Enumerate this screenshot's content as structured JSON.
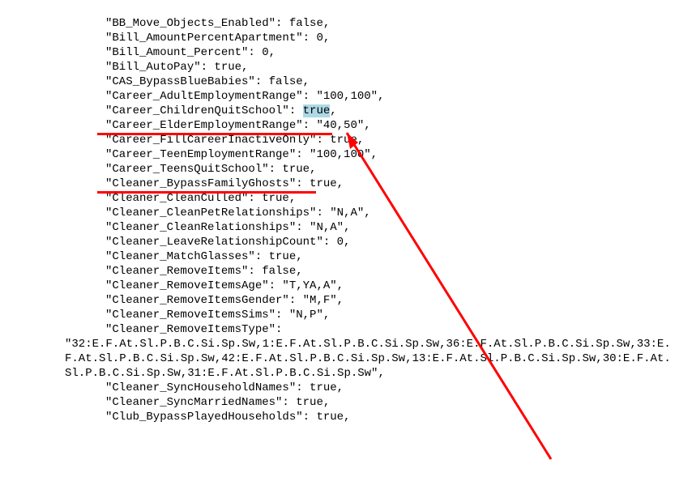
{
  "lines": {
    "l1": "\"BB_Move_Objects_Enabled\": false,",
    "l2": "\"Bill_AmountPercentApartment\": 0,",
    "l3": "\"Bill_Amount_Percent\": 0,",
    "l4": "\"Bill_AutoPay\": true,",
    "l5": "\"CAS_BypassBlueBabies\": false,",
    "l6": "\"Career_AdultEmploymentRange\": \"100,100\",",
    "l7a": "\"Career_ChildrenQuitSchool\": ",
    "l7b": "true",
    "l7c": ",",
    "l8": "\"Career_ElderEmploymentRange\": \"40,50\",",
    "l9": "\"Career_FillCareerInactiveOnly\": true,",
    "l10": "\"Career_TeenEmploymentRange\": \"100,100\",",
    "l11": "\"Career_TeensQuitSchool\": true,",
    "l12": "\"Cleaner_BypassFamilyGhosts\": true,",
    "l13": "\"Cleaner_CleanCulled\": true,",
    "l14": "\"Cleaner_CleanPetRelationships\": \"N,A\",",
    "l15": "\"Cleaner_CleanRelationships\": \"N,A\",",
    "l16": "\"Cleaner_LeaveRelationshipCount\": 0,",
    "l17": "\"Cleaner_MatchGlasses\": true,",
    "l18": "\"Cleaner_RemoveItems\": false,",
    "l19": "\"Cleaner_RemoveItemsAge\": \"T,YA,A\",",
    "l20": "\"Cleaner_RemoveItemsGender\": \"M,F\",",
    "l21": "\"Cleaner_RemoveItemsSims\": \"N,P\",",
    "l22": "\"Cleaner_RemoveItemsType\":",
    "l23": "\"32:E.F.At.Sl.P.B.C.Si.Sp.Sw,1:E.F.At.Sl.P.B.C.Si.Sp.Sw,36:E.F.At.Sl.P.B.C.Si.Sp.Sw,33:E.F.At.Sl.P.B.C.Si.Sp.Sw,42:E.F.At.Sl.P.B.C.Si.Sp.Sw,13:E.F.At.Sl.P.B.C.Si.Sp.Sw,30:E.F.At.Sl.P.B.C.Si.Sp.Sw,31:E.F.At.Sl.P.B.C.Si.Sp.Sw\",",
    "l24": "\"Cleaner_SyncHouseholdNames\": true,",
    "l25": "\"Cleaner_SyncMarriedNames\": true,",
    "l26": "\"Club_BypassPlayedHouseholds\": true,"
  },
  "annotations": {
    "underline1_key": "Career_ChildrenQuitSchool",
    "underline2_key": "Career_TeensQuitSchool",
    "selected_value": "true",
    "arrow_points_to_value": "true"
  }
}
